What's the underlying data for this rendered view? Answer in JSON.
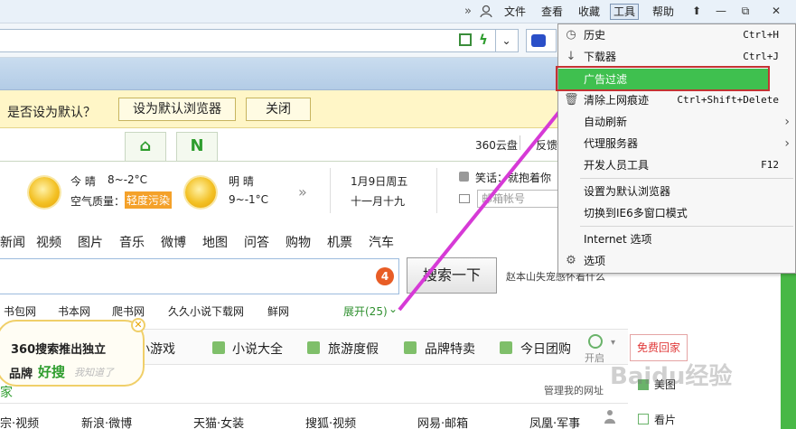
{
  "menubar": {
    "items": [
      "文件",
      "查看",
      "收藏",
      "工具",
      "帮助"
    ],
    "overflow_symbol": "»",
    "window_buttons": [
      "⬆",
      "—",
      "⧉",
      "✕"
    ]
  },
  "notification": {
    "question": "是否设为默认？",
    "set_default_label": "设为默认浏览器",
    "close_label": "关闭"
  },
  "header": {
    "tab_home_symbol": "⌂",
    "tab_n_label": "N",
    "cloud_label": "360云盘",
    "feedback_label": "反馈"
  },
  "weather": {
    "today_label": "今 晴",
    "today_temp": "8~-2°C",
    "air_label": "空气质量：",
    "air_value": "轻度污染",
    "tomorrow_label": "明 晴",
    "tomorrow_temp": "9~-1°C",
    "more_symbol": "»"
  },
  "date": {
    "solar": "1月9日周五",
    "lunar": "十一月十九"
  },
  "joke": {
    "label": "笑话：就抱着你",
    "mail_placeholder": "邮箱帐号"
  },
  "nav": [
    "新闻",
    "视频",
    "图片",
    "音乐",
    "微博",
    "地图",
    "问答",
    "购物",
    "机票",
    "汽车"
  ],
  "search": {
    "badge": "4",
    "button_label": "搜索一下",
    "hint": "赵本山失宠感怀着什么"
  },
  "quicklinks": [
    "书包网",
    "书本网",
    "爬书网",
    "久久小说下载网",
    "鲜网"
  ],
  "expand_label": "展开(25)",
  "bubble": {
    "line1": "360搜索推出独立",
    "line2_prefix": "品牌",
    "line2_brand": "好搜",
    "line2_suffix": "我知道了"
  },
  "bottom_tabs": [
    "小游戏",
    "小说大全",
    "旅游度假",
    "品牌特卖",
    "今日团购"
  ],
  "bottom_misc": {
    "open_label": "开启",
    "free_label": "免费回家",
    "manage_label": "管理我的网址",
    "side1": "美图",
    "side2": "看片",
    "leftchar": "家"
  },
  "linksrow": [
    "宗·视频",
    "新浪·微博",
    "天猫·女装",
    "搜狐·视频",
    "网易·邮箱",
    "凤凰·军事"
  ],
  "dropdown": {
    "items": [
      {
        "icon": "clock-icon",
        "glyph": "◷",
        "label": "历史",
        "shortcut": "Ctrl+H"
      },
      {
        "icon": "download-icon",
        "glyph": "↓",
        "label": "下载器",
        "shortcut": "Ctrl+J"
      },
      {
        "icon": "",
        "glyph": "",
        "label": "广告过滤",
        "shortcut": ""
      },
      {
        "icon": "trash-icon",
        "glyph": "🗑",
        "label": "清除上网痕迹",
        "shortcut": "Ctrl+Shift+Delete"
      },
      {
        "icon": "",
        "glyph": "",
        "label": "自动刷新",
        "shortcut": ""
      },
      {
        "icon": "",
        "glyph": "",
        "label": "代理服务器",
        "shortcut": ""
      },
      {
        "icon": "",
        "glyph": "",
        "label": "开发人员工具",
        "shortcut": "F12"
      },
      {
        "icon": "",
        "glyph": "",
        "label": "设置为默认浏览器",
        "shortcut": ""
      },
      {
        "icon": "",
        "glyph": "",
        "label": "切换到IE6多窗口模式",
        "shortcut": ""
      },
      {
        "icon": "",
        "glyph": "",
        "label": "Internet 选项",
        "shortcut": ""
      },
      {
        "icon": "gear-icon",
        "glyph": "⚙",
        "label": "选项",
        "shortcut": ""
      }
    ],
    "submenu_arrow": "›"
  },
  "colors": {
    "highlight": "#3fc04f",
    "annotation": "#c43333",
    "arrow": "#d63ad6"
  },
  "watermark": "Baidu经验"
}
